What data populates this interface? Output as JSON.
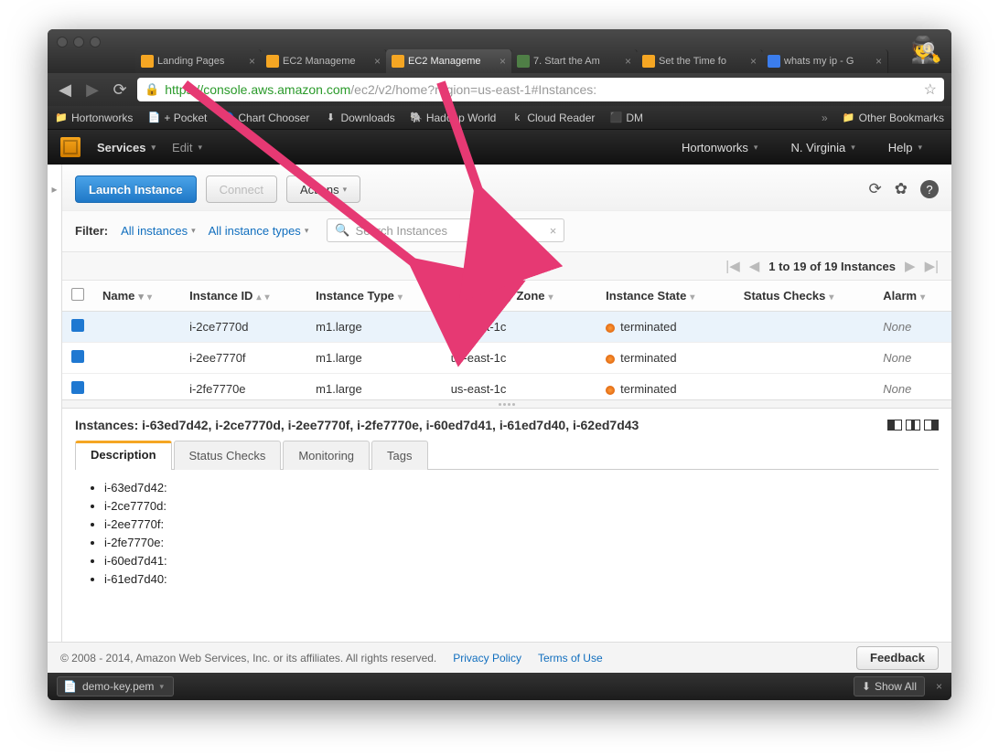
{
  "browser": {
    "tabs": [
      {
        "label": "Landing Pages",
        "favcolor": "#f5a623"
      },
      {
        "label": "EC2 Manageme",
        "favcolor": "#f5a623"
      },
      {
        "label": "EC2 Manageme",
        "favcolor": "#f5a623",
        "active": true
      },
      {
        "label": "7. Start the Am",
        "favcolor": "#4f7f46"
      },
      {
        "label": "Set the Time fo",
        "favcolor": "#f5a623"
      },
      {
        "label": "whats my ip - G",
        "favcolor": "#3b7ded"
      }
    ],
    "url_https": "https",
    "url_host": "://console.aws.amazon.com",
    "url_path": "/ec2/v2/home?region=us-east-1#Instances:",
    "bookmarks": [
      "Hortonworks",
      "+ Pocket",
      "Chart Chooser",
      "Downloads",
      "Hadoop World",
      "Cloud Reader",
      "DM"
    ],
    "other_bookmarks": "Other Bookmarks"
  },
  "aws_header": {
    "services": "Services",
    "edit": "Edit",
    "account": "Hortonworks",
    "region": "N. Virginia",
    "help": "Help"
  },
  "toolbar": {
    "launch": "Launch Instance",
    "connect": "Connect",
    "actions": "Actions"
  },
  "filter": {
    "label": "Filter:",
    "all_instances": "All instances",
    "all_types": "All instance types",
    "search_placeholder": "Search Instances"
  },
  "pager": {
    "text": "1 to 19 of 19 Instances"
  },
  "table": {
    "cols": [
      "Name",
      "Instance ID",
      "Instance Type",
      "Availability Zone",
      "Instance State",
      "Status Checks",
      "Alarm"
    ],
    "rows": [
      {
        "id": "i-2ce7770d",
        "type": "m1.large",
        "az": "us-east-1c",
        "state": "terminated",
        "alarm": "None"
      },
      {
        "id": "i-2ee7770f",
        "type": "m1.large",
        "az": "us-east-1c",
        "state": "terminated",
        "alarm": "None"
      },
      {
        "id": "i-2fe7770e",
        "type": "m1.large",
        "az": "us-east-1c",
        "state": "terminated",
        "alarm": "None"
      }
    ]
  },
  "detail": {
    "title_prefix": "Instances:",
    "title_ids": "i-63ed7d42, i-2ce7770d, i-2ee7770f, i-2fe7770e, i-60ed7d41, i-61ed7d40, i-62ed7d43",
    "tabs": [
      "Description",
      "Status Checks",
      "Monitoring",
      "Tags"
    ],
    "bullets": [
      "i-63ed7d42:",
      "i-2ce7770d:",
      "i-2ee7770f:",
      "i-2fe7770e:",
      "i-60ed7d41:",
      "i-61ed7d40:"
    ]
  },
  "footer": {
    "copyright": "© 2008 - 2014, Amazon Web Services, Inc. or its affiliates. All rights reserved.",
    "privacy": "Privacy Policy",
    "terms": "Terms of Use",
    "feedback": "Feedback"
  },
  "download": {
    "file": "demo-key.pem",
    "showall": "Show All"
  }
}
